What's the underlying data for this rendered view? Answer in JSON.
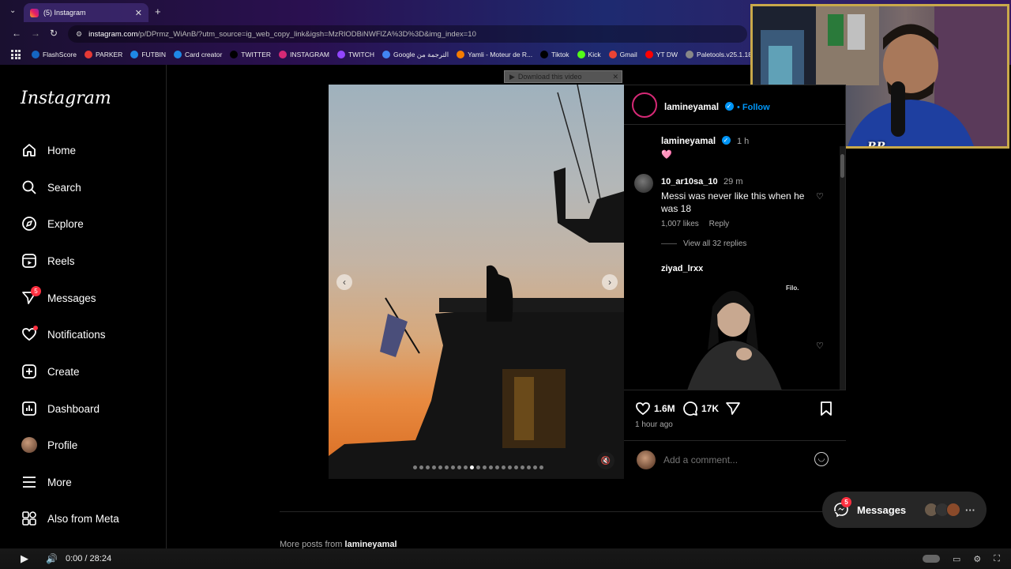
{
  "browser": {
    "tab_title": "(5) Instagram",
    "url_host": "instagram.com",
    "url_path": "/p/DPrmz_WiAnB/?utm_source=ig_web_copy_link&igsh=MzRlODBiNWFlZA%3D%3D&img_index=10",
    "bookmarks": [
      {
        "label": "FlashScore",
        "color": "#1565c0"
      },
      {
        "label": "PARKER",
        "color": "#e53935"
      },
      {
        "label": "FUTBIN",
        "color": "#1e88e5"
      },
      {
        "label": "Card creator",
        "color": "#1e88e5"
      },
      {
        "label": "TWITTER",
        "color": "#000000"
      },
      {
        "label": "INSTAGRAM",
        "color": "#d62976"
      },
      {
        "label": "TWITCH",
        "color": "#9146ff"
      },
      {
        "label": "Google الترجمة من",
        "color": "#4285f4"
      },
      {
        "label": "Yamli - Moteur de R...",
        "color": "#f57c00"
      },
      {
        "label": "Tiktok",
        "color": "#000000"
      },
      {
        "label": "Kick",
        "color": "#53fc18"
      },
      {
        "label": "Gmail",
        "color": "#ea4335"
      },
      {
        "label": "YT DW",
        "color": "#ff0000"
      },
      {
        "label": "Paletools.v25.1.18",
        "color": "#888888"
      }
    ]
  },
  "sidebar": {
    "logo": "Instagram",
    "items": [
      {
        "label": "Home",
        "icon": "home-icon"
      },
      {
        "label": "Search",
        "icon": "search-icon"
      },
      {
        "label": "Explore",
        "icon": "compass-icon"
      },
      {
        "label": "Reels",
        "icon": "reels-icon"
      },
      {
        "label": "Messages",
        "icon": "messenger-icon",
        "badge": "5"
      },
      {
        "label": "Notifications",
        "icon": "heart-icon"
      },
      {
        "label": "Create",
        "icon": "plus-icon"
      },
      {
        "label": "Dashboard",
        "icon": "dashboard-icon"
      },
      {
        "label": "Profile",
        "icon": "avatar"
      },
      {
        "label": "More",
        "icon": "menu-icon"
      },
      {
        "label": "Also from Meta",
        "icon": "meta-icon"
      }
    ]
  },
  "download_bar": "Download this video",
  "post": {
    "author": "lamineyamal",
    "follow": "Follow",
    "caption_author": "lamineyamal",
    "caption_time": "1 h",
    "caption_emoji": "🩷",
    "comments": [
      {
        "user": "10_ar10sa_10",
        "time": "29 m",
        "text": "Messi was never like this when he was 18",
        "likes": "1,007 likes",
        "reply": "Reply",
        "view_replies": "View all 32 replies"
      },
      {
        "user": "ziyad_lrxx",
        "media_label": "Filo."
      }
    ],
    "likes": "1.6M",
    "comments_count": "17K",
    "posted": "1 hour ago",
    "add_comment_placeholder": "Add a comment...",
    "carousel_total": 21,
    "carousel_index": 10
  },
  "messages_pill": {
    "label": "Messages",
    "badge": "5"
  },
  "more_posts": {
    "prefix": "More posts from",
    "user": "lamineyamal"
  },
  "player": {
    "time": "0:00 / 28:24"
  },
  "webcam": {
    "logo": "RR"
  }
}
